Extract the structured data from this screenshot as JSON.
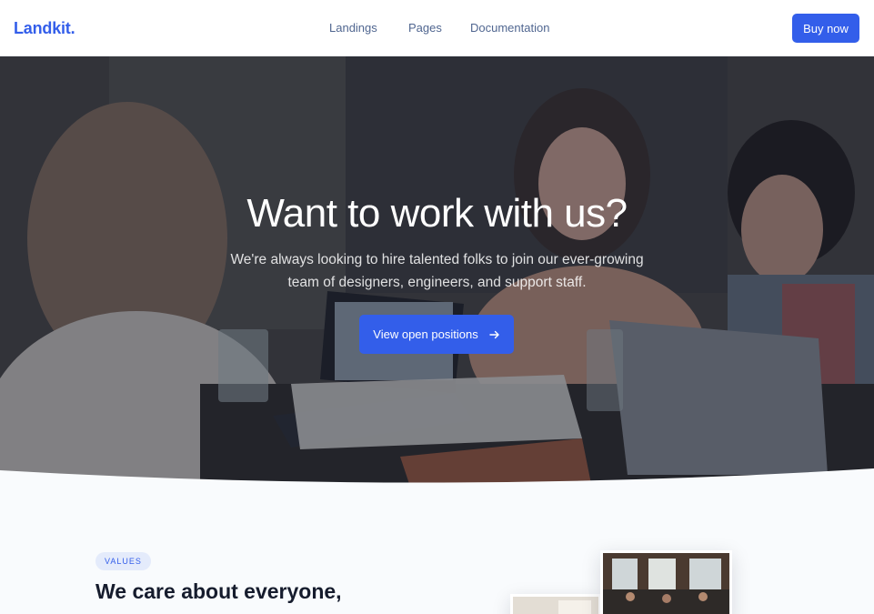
{
  "navbar": {
    "brand": "Landkit.",
    "links": [
      "Landings",
      "Pages",
      "Documentation"
    ],
    "cta": "Buy now"
  },
  "hero": {
    "title": "Want to work with us?",
    "subtitle": "We're always looking to hire talented folks to join our ever-growing team of designers, engineers, and support staff.",
    "button": "View open positions",
    "button_icon": "arrow-right-icon",
    "background_image": "photo-people-working-at-table"
  },
  "values": {
    "badge": "VALUES",
    "title": "We care about everyone,"
  },
  "colors": {
    "primary": "#335eea",
    "nav_text": "#506690",
    "heading": "#161c2d",
    "section_bg": "#f9fbfd"
  }
}
